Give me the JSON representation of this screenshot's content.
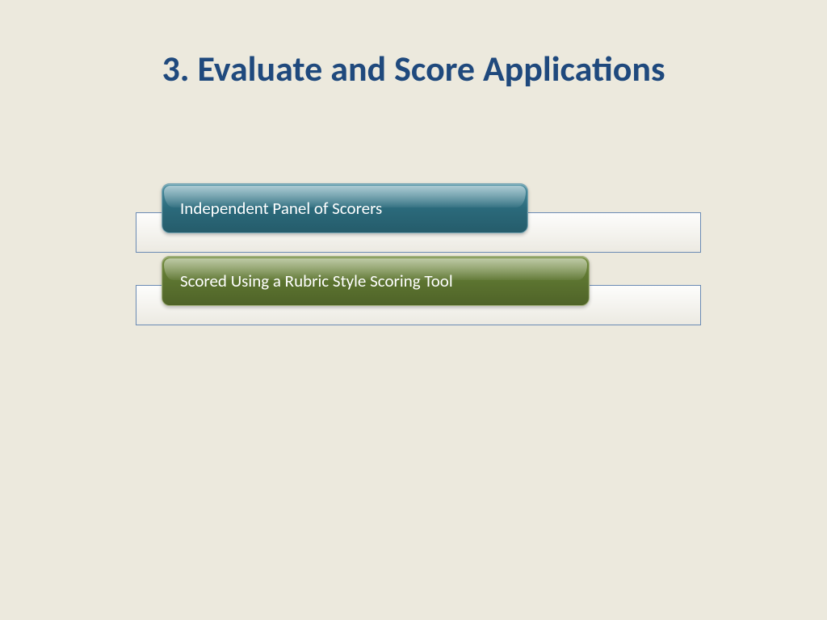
{
  "slide": {
    "title": "3. Evaluate and Score Applications",
    "items": [
      {
        "label": "Independent Panel of Scorers"
      },
      {
        "label": "Scored Using a Rubric Style Scoring Tool"
      }
    ]
  },
  "colors": {
    "background": "#ece9dd",
    "title": "#1f497d",
    "teal": "#2b6a7b",
    "olive": "#5c7430",
    "bar_border": "#6a8ab3"
  }
}
